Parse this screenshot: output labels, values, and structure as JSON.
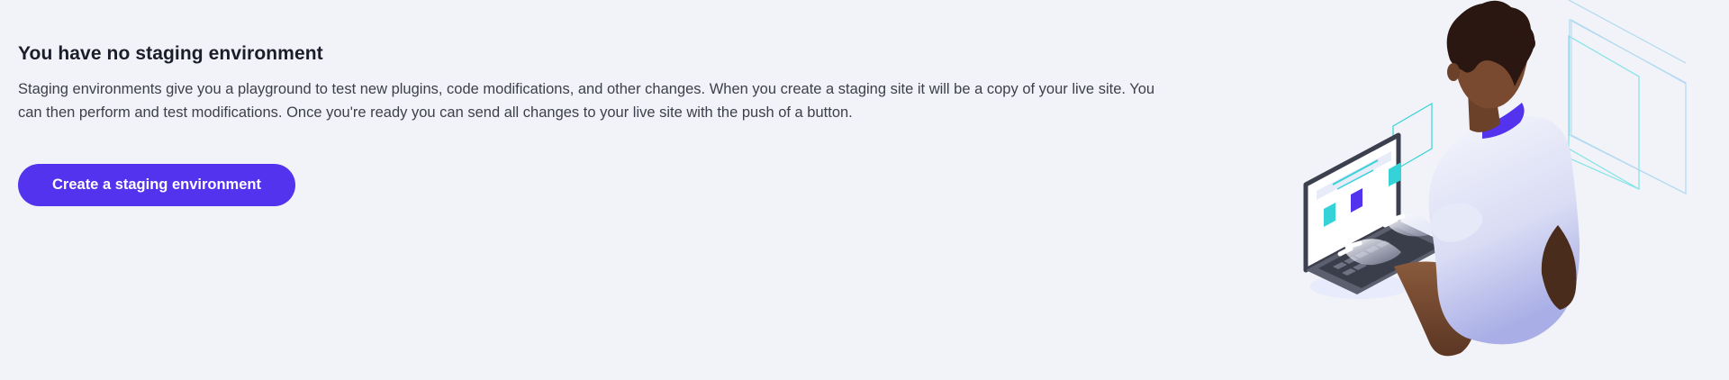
{
  "empty_state": {
    "title": "You have no staging environment",
    "description": "Staging environments give you a playground to test new plugins, code modifications, and other changes. When you create a staging site it will be a copy of your live site. You can then perform and test modifications. Once you're ready you can send all changes to your live site with the push of a button.",
    "create_button_label": "Create a staging environment"
  },
  "colors": {
    "background": "#f2f3f8",
    "primary": "#5333ed",
    "heading": "#1b1d2b",
    "body_text": "#3d3f4a",
    "accent_teal": "#35d3d8"
  },
  "illustration": {
    "subject": "person-working-on-laptop-illustration"
  }
}
